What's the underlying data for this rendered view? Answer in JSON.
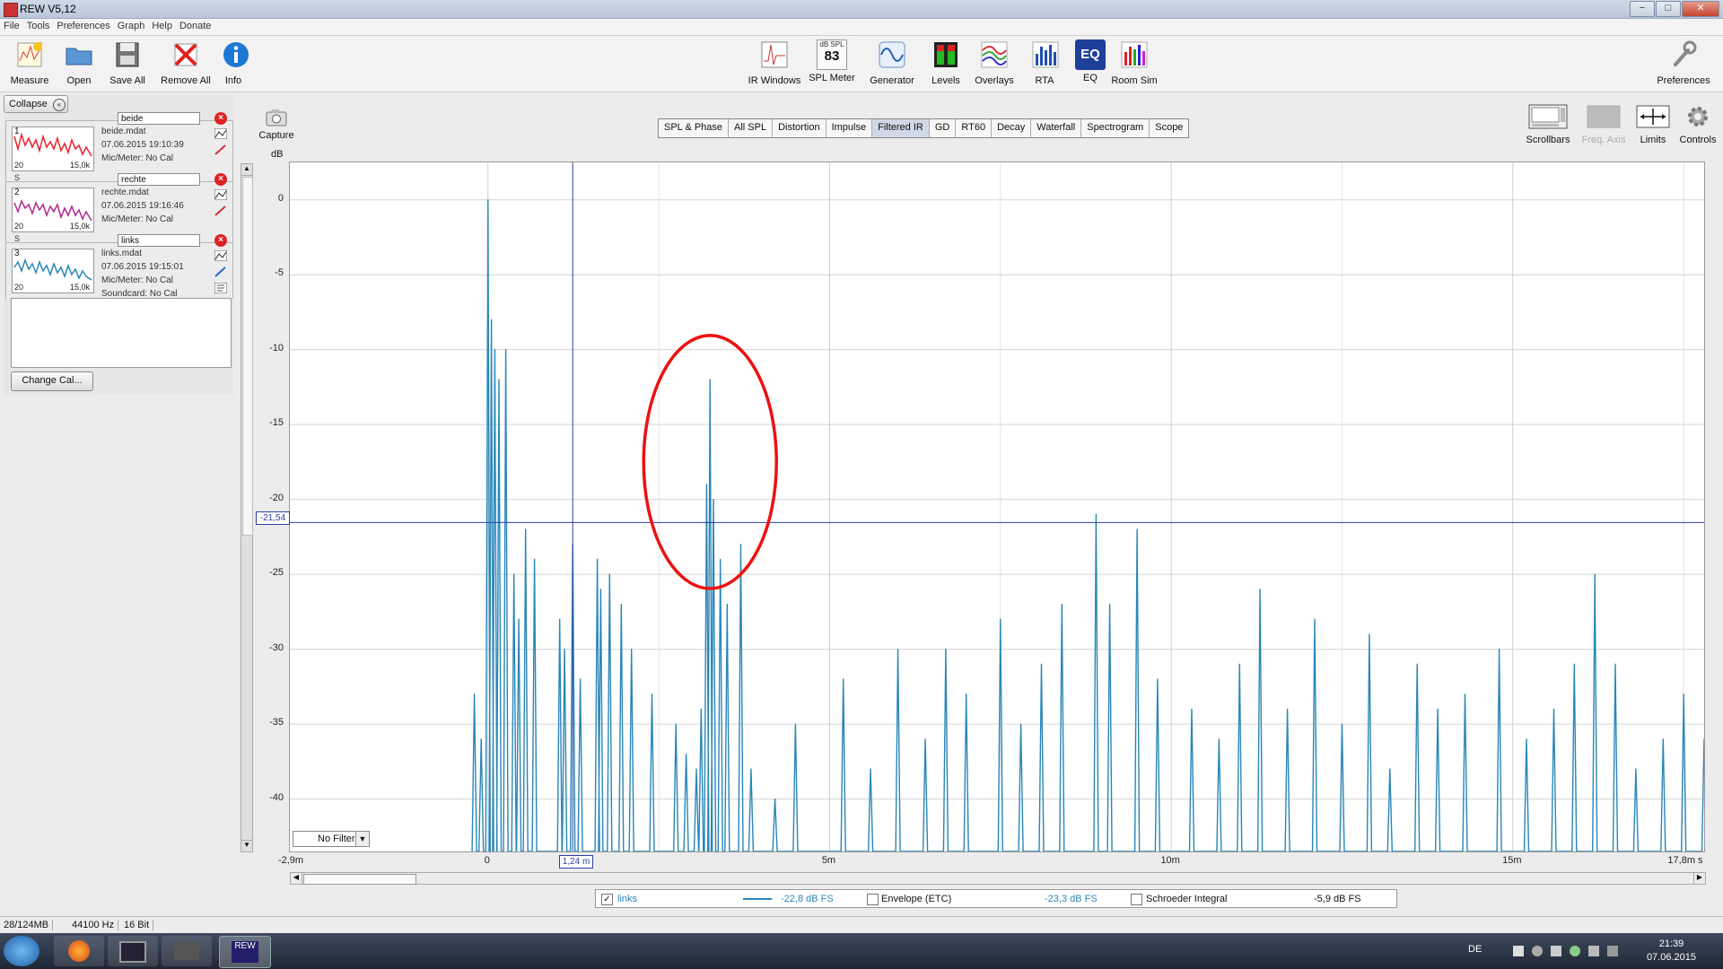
{
  "window": {
    "title": "REW V5,12",
    "minimize": "−",
    "maximize": "□",
    "close": "✕"
  },
  "menu": [
    "File",
    "Tools",
    "Preferences",
    "Graph",
    "Help",
    "Donate"
  ],
  "toolbar": {
    "left": [
      "Measure",
      "Open",
      "Save All",
      "Remove All",
      "Info"
    ],
    "center": [
      "IR Windows",
      "SPL Meter",
      "Generator",
      "Levels",
      "Overlays",
      "RTA",
      "EQ",
      "Room Sim"
    ],
    "spl_meter_badge": "dB SPL",
    "spl_meter_value": "83",
    "eq_badge": "EQ",
    "preferences": "Preferences"
  },
  "panel": {
    "collapse_label": "Collapse",
    "collapse_icon": "chevron-double-left-icon",
    "measurements": [
      {
        "num": "1",
        "name": "beide",
        "file": "beide.mdat",
        "date": "07.06.2015 19:10:39",
        "mic": "Mic/Meter: No Cal",
        "soundcard": "S",
        "color": "#e8252e"
      },
      {
        "num": "2",
        "name": "rechte",
        "file": "rechte.mdat",
        "date": "07.06.2015 19:16:46",
        "mic": "Mic/Meter: No Cal",
        "soundcard": "S",
        "color": "#b0288e"
      },
      {
        "num": "3",
        "name": "links",
        "file": "links.mdat",
        "date": "07.06.2015 19:15:01",
        "mic": "Mic/Meter: No Cal",
        "soundcard": "Soundcard: No Cal",
        "color": "#2a86b8"
      }
    ],
    "thumb_x_start": "20",
    "thumb_x_end": "15,0k",
    "change_cal": "Change Cal..."
  },
  "capture_label": "Capture",
  "graph_tabs": [
    "SPL & Phase",
    "All SPL",
    "Distortion",
    "Impulse",
    "Filtered IR",
    "GD",
    "RT60",
    "Decay",
    "Waterfall",
    "Spectrogram",
    "Scope"
  ],
  "active_tab": "Filtered IR",
  "right_tools": [
    "Scrollbars",
    "Freq. Axis",
    "Limits",
    "Controls"
  ],
  "chart_data": {
    "type": "line",
    "ylabel": "dB",
    "xlabel": "",
    "y_ticks": [
      "0",
      "-5",
      "-10",
      "-15",
      "-20",
      "-25",
      "-30",
      "-35",
      "-40"
    ],
    "x_tick_labels": [
      "-2,9m",
      "0",
      "5m",
      "10m",
      "15m",
      "17,8m s"
    ],
    "x_tick_values": [
      -2.9,
      0,
      5,
      10,
      15,
      17.8
    ],
    "xlim": [
      -2.9,
      17.8
    ],
    "ylim": [
      -43.5,
      2.5
    ],
    "grid": true,
    "cursor": {
      "x_label": "1,24 m",
      "x": 1.24,
      "y_label": "-21,54",
      "y": -21.54
    },
    "annotation": "red ellipse highlighting reflection peak near 3.2 m",
    "series": [
      {
        "name": "links",
        "color": "#2a86b8",
        "peaks": [
          [
            -0.2,
            -33
          ],
          [
            -0.1,
            -36
          ],
          [
            0.0,
            0
          ],
          [
            0.05,
            -8
          ],
          [
            0.1,
            -10
          ],
          [
            0.16,
            -12
          ],
          [
            0.26,
            -10
          ],
          [
            0.38,
            -25
          ],
          [
            0.45,
            -28
          ],
          [
            0.55,
            -22
          ],
          [
            0.68,
            -24
          ],
          [
            1.05,
            -28
          ],
          [
            1.12,
            -30
          ],
          [
            1.24,
            -23
          ],
          [
            1.35,
            -32
          ],
          [
            1.6,
            -24
          ],
          [
            1.65,
            -26
          ],
          [
            1.78,
            -25
          ],
          [
            1.95,
            -27
          ],
          [
            2.1,
            -30
          ],
          [
            2.4,
            -33
          ],
          [
            2.75,
            -35
          ],
          [
            2.9,
            -37
          ],
          [
            3.05,
            -38
          ],
          [
            3.12,
            -34
          ],
          [
            3.2,
            -19
          ],
          [
            3.25,
            -12
          ],
          [
            3.3,
            -20
          ],
          [
            3.4,
            -24
          ],
          [
            3.5,
            -27
          ],
          [
            3.7,
            -23
          ],
          [
            3.85,
            -38
          ],
          [
            4.2,
            -40
          ],
          [
            4.5,
            -35
          ],
          [
            5.2,
            -32
          ],
          [
            5.6,
            -38
          ],
          [
            6.0,
            -30
          ],
          [
            6.4,
            -36
          ],
          [
            6.7,
            -30
          ],
          [
            7.0,
            -33
          ],
          [
            7.5,
            -28
          ],
          [
            7.8,
            -35
          ],
          [
            8.1,
            -31
          ],
          [
            8.4,
            -27
          ],
          [
            8.9,
            -21
          ],
          [
            9.1,
            -27
          ],
          [
            9.5,
            -22
          ],
          [
            9.8,
            -32
          ],
          [
            10.3,
            -34
          ],
          [
            10.7,
            -36
          ],
          [
            11.0,
            -31
          ],
          [
            11.3,
            -26
          ],
          [
            11.7,
            -34
          ],
          [
            12.1,
            -28
          ],
          [
            12.5,
            -35
          ],
          [
            12.9,
            -29
          ],
          [
            13.2,
            -38
          ],
          [
            13.6,
            -31
          ],
          [
            13.9,
            -34
          ],
          [
            14.3,
            -33
          ],
          [
            14.8,
            -30
          ],
          [
            15.2,
            -36
          ],
          [
            15.6,
            -34
          ],
          [
            15.9,
            -31
          ],
          [
            16.2,
            -25
          ],
          [
            16.5,
            -31
          ],
          [
            16.8,
            -38
          ],
          [
            17.2,
            -36
          ],
          [
            17.5,
            -33
          ],
          [
            17.8,
            -36
          ]
        ]
      }
    ]
  },
  "filter": {
    "value": "No Filter"
  },
  "legend": {
    "items": [
      {
        "label": "links",
        "value": "-22,8 dB FS",
        "checked": true,
        "color": "#2a86b8"
      },
      {
        "label": "Envelope (ETC)",
        "value": "-23,3 dB FS",
        "checked": false
      },
      {
        "label": "Schroeder Integral",
        "value": "-5,9 dB FS",
        "checked": false
      }
    ]
  },
  "status": [
    "28/124MB",
    "44100 Hz",
    "16 Bit"
  ],
  "taskbar": {
    "lang": "DE",
    "time": "21:39",
    "date": "07.06.2015"
  }
}
